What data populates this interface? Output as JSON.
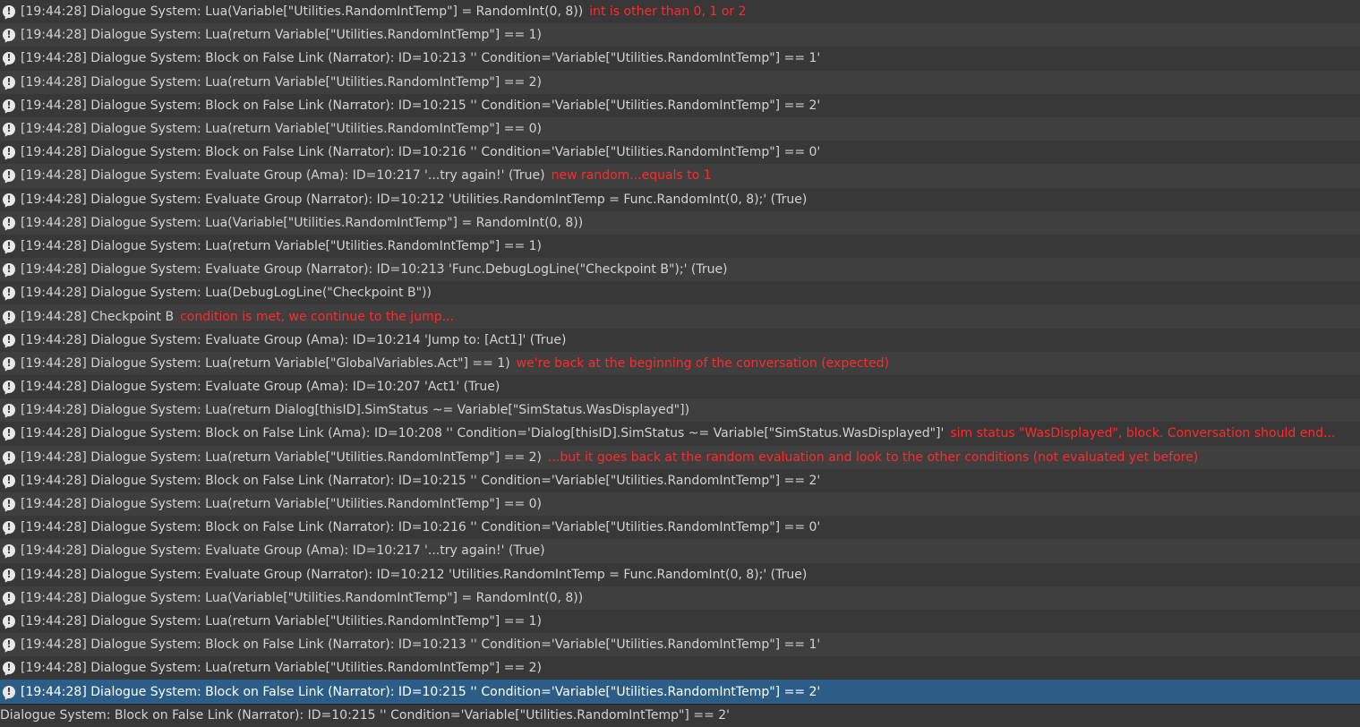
{
  "console": {
    "entries": [
      {
        "text": "[19:44:28] Dialogue System: Lua(Variable[\"Utilities.RandomIntTemp\"] = RandomInt(0, 8))",
        "note": "int is other than 0, 1 or 2"
      },
      {
        "text": "[19:44:28] Dialogue System: Lua(return Variable[\"Utilities.RandomIntTemp\"] == 1)",
        "note": ""
      },
      {
        "text": "[19:44:28] Dialogue System: Block on False Link (Narrator): ID=10:213 '' Condition='Variable[\"Utilities.RandomIntTemp\"] == 1'",
        "note": ""
      },
      {
        "text": "[19:44:28] Dialogue System: Lua(return Variable[\"Utilities.RandomIntTemp\"] == 2)",
        "note": ""
      },
      {
        "text": "[19:44:28] Dialogue System: Block on False Link (Narrator): ID=10:215 '' Condition='Variable[\"Utilities.RandomIntTemp\"] == 2'",
        "note": ""
      },
      {
        "text": "[19:44:28] Dialogue System: Lua(return Variable[\"Utilities.RandomIntTemp\"] == 0)",
        "note": ""
      },
      {
        "text": "[19:44:28] Dialogue System: Block on False Link (Narrator): ID=10:216 '' Condition='Variable[\"Utilities.RandomIntTemp\"] == 0'",
        "note": ""
      },
      {
        "text": "[19:44:28] Dialogue System: Evaluate Group (Ama): ID=10:217 '...try again!' (True)",
        "note": "new random...equals to 1"
      },
      {
        "text": "[19:44:28] Dialogue System: Evaluate Group (Narrator): ID=10:212 'Utilities.RandomIntTemp = Func.RandomInt(0, 8);' (True)",
        "note": ""
      },
      {
        "text": "[19:44:28] Dialogue System: Lua(Variable[\"Utilities.RandomIntTemp\"] = RandomInt(0, 8))",
        "note": ""
      },
      {
        "text": "[19:44:28] Dialogue System: Lua(return Variable[\"Utilities.RandomIntTemp\"] == 1)",
        "note": ""
      },
      {
        "text": "[19:44:28] Dialogue System: Evaluate Group (Narrator): ID=10:213 'Func.DebugLogLine(\"Checkpoint B\");' (True)",
        "note": ""
      },
      {
        "text": "[19:44:28] Dialogue System: Lua(DebugLogLine(\"Checkpoint B\"))",
        "note": ""
      },
      {
        "text": "[19:44:28] Checkpoint B",
        "note": "condition is met, we continue to the jump..."
      },
      {
        "text": "[19:44:28] Dialogue System: Evaluate Group (Ama): ID=10:214 'Jump to: [Act1]' (True)",
        "note": ""
      },
      {
        "text": "[19:44:28] Dialogue System: Lua(return Variable[\"GlobalVariables.Act\"] == 1)",
        "note": "we're back at the beginning of the conversation (expected)"
      },
      {
        "text": "[19:44:28] Dialogue System: Evaluate Group (Ama): ID=10:207 'Act1' (True)",
        "note": ""
      },
      {
        "text": "[19:44:28] Dialogue System: Lua(return Dialog[thisID].SimStatus ~= Variable[\"SimStatus.WasDisplayed\"])",
        "note": ""
      },
      {
        "text": "[19:44:28] Dialogue System: Block on False Link (Ama): ID=10:208 '' Condition='Dialog[thisID].SimStatus ~= Variable[\"SimStatus.WasDisplayed\"]'",
        "note": "sim status \"WasDisplayed\", block. Conversation should end..."
      },
      {
        "text": "[19:44:28] Dialogue System: Lua(return Variable[\"Utilities.RandomIntTemp\"] == 2)",
        "note": "...but it goes back at the random evaluation and look to the other conditions (not evaluated yet before)"
      },
      {
        "text": "[19:44:28] Dialogue System: Block on False Link (Narrator): ID=10:215 '' Condition='Variable[\"Utilities.RandomIntTemp\"] == 2'",
        "note": ""
      },
      {
        "text": "[19:44:28] Dialogue System: Lua(return Variable[\"Utilities.RandomIntTemp\"] == 0)",
        "note": ""
      },
      {
        "text": "[19:44:28] Dialogue System: Block on False Link (Narrator): ID=10:216 '' Condition='Variable[\"Utilities.RandomIntTemp\"] == 0'",
        "note": ""
      },
      {
        "text": "[19:44:28] Dialogue System: Evaluate Group (Ama): ID=10:217 '...try again!' (True)",
        "note": ""
      },
      {
        "text": "[19:44:28] Dialogue System: Evaluate Group (Narrator): ID=10:212 'Utilities.RandomIntTemp = Func.RandomInt(0, 8);' (True)",
        "note": ""
      },
      {
        "text": "[19:44:28] Dialogue System: Lua(Variable[\"Utilities.RandomIntTemp\"] = RandomInt(0, 8))",
        "note": ""
      },
      {
        "text": "[19:44:28] Dialogue System: Lua(return Variable[\"Utilities.RandomIntTemp\"] == 1)",
        "note": ""
      },
      {
        "text": "[19:44:28] Dialogue System: Block on False Link (Narrator): ID=10:213 '' Condition='Variable[\"Utilities.RandomIntTemp\"] == 1'",
        "note": ""
      },
      {
        "text": "[19:44:28] Dialogue System: Lua(return Variable[\"Utilities.RandomIntTemp\"] == 2)",
        "note": ""
      },
      {
        "text": "[19:44:28] Dialogue System: Block on False Link (Narrator): ID=10:215 '' Condition='Variable[\"Utilities.RandomIntTemp\"] == 2'",
        "note": "",
        "selected": true
      }
    ],
    "details_text": "Dialogue System: Block on False Link (Narrator): ID=10:215 '' Condition='Variable[\"Utilities.RandomIntTemp\"] == 2'",
    "icon_glyph": "!",
    "colors": {
      "background": "#383838",
      "row_alt": "#3f3f3f",
      "selected": "#2c5d87",
      "text": "#d2d2d2",
      "annotation": "#ff2a2a"
    }
  }
}
